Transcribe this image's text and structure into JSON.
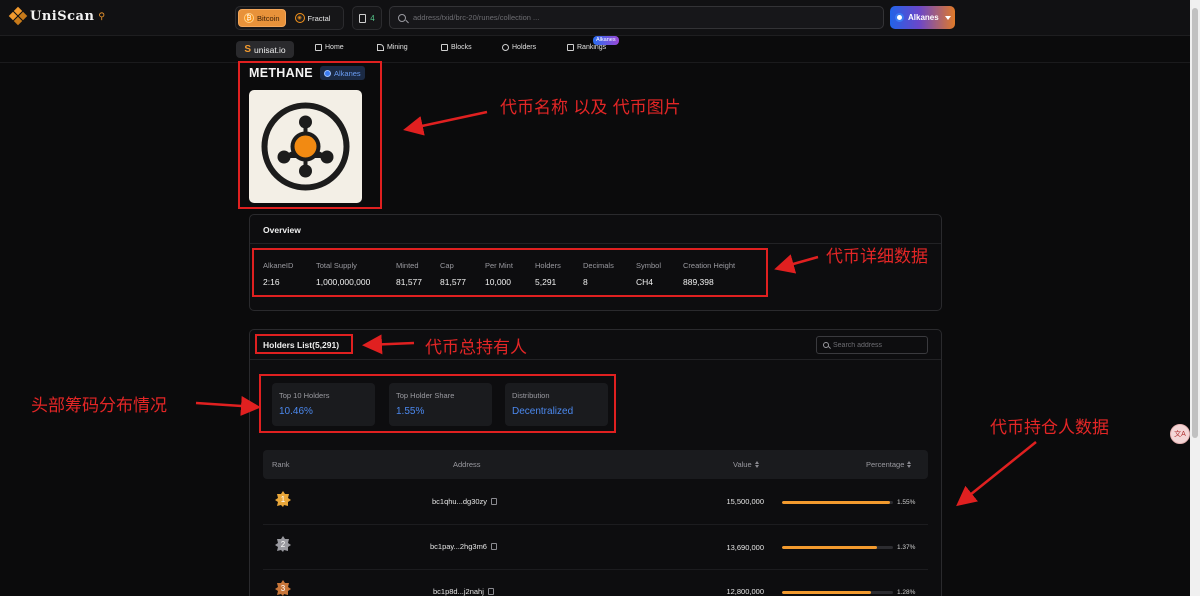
{
  "app": {
    "logo_text": "UniScan",
    "chains": [
      {
        "label": "Bitcoin",
        "active": true
      },
      {
        "label": "Fractal",
        "active": false
      }
    ],
    "gas_count": "4",
    "search_placeholder": "address/txid/brc-20/runes/collection ...",
    "network_label": "Alkanes"
  },
  "nav": {
    "brand": "unisat.io",
    "items": [
      {
        "label": "Home",
        "icon": "home-icon"
      },
      {
        "label": "Mining",
        "icon": "pickaxe-icon"
      },
      {
        "label": "Blocks",
        "icon": "cube-icon"
      },
      {
        "label": "Holders",
        "icon": "user-icon"
      },
      {
        "label": "Rankings",
        "icon": "chart-icon",
        "badge": "Alkanes"
      }
    ]
  },
  "token": {
    "name": "METHANE",
    "tag": "Alkanes",
    "image_icon": "molecule-icon"
  },
  "overview": {
    "title": "Overview",
    "stats": [
      {
        "label": "AlkaneID",
        "value": "2:16"
      },
      {
        "label": "Total Supply",
        "value": "1,000,000,000"
      },
      {
        "label": "Minted",
        "value": "81,577"
      },
      {
        "label": "Cap",
        "value": "81,577"
      },
      {
        "label": "Per Mint",
        "value": "10,000"
      },
      {
        "label": "Holders",
        "value": "5,291"
      },
      {
        "label": "Decimals",
        "value": "8"
      },
      {
        "label": "Symbol",
        "value": "CH4"
      },
      {
        "label": "Creation Height",
        "value": "889,398"
      }
    ]
  },
  "holders": {
    "title": "Holders List(5,291)",
    "search_placeholder": "Search address",
    "metrics": [
      {
        "label": "Top 10 Holders",
        "value": "10.46%"
      },
      {
        "label": "Top Holder Share",
        "value": "1.55%"
      },
      {
        "label": "Distribution",
        "value": "Decentralized"
      }
    ],
    "columns": {
      "rank": "Rank",
      "address": "Address",
      "value": "Value",
      "percentage": "Percentage"
    },
    "rows": [
      {
        "rank": "1",
        "address": "bc1qhu...dg30zy",
        "value": "15,500,000",
        "percentage": "1.55%",
        "fraction": 0.0155,
        "medal_color": "#e9a73a"
      },
      {
        "rank": "2",
        "address": "bc1pay...2hg3m6",
        "value": "13,690,000",
        "percentage": "1.37%",
        "fraction": 0.0137,
        "medal_color": "#9a9aa0"
      },
      {
        "rank": "3",
        "address": "bc1p8d...j2nahj",
        "value": "12,800,000",
        "percentage": "1.28%",
        "fraction": 0.0128,
        "medal_color": "#c8763a"
      }
    ]
  },
  "annotations": {
    "token_image": "代币名称 以及 代币图片",
    "details": "代币详细数据",
    "total_holders": "代币总持有人",
    "distribution": "头部筹码分布情况",
    "holding_data": "代币持仓人数据"
  },
  "translate_label": "文A"
}
